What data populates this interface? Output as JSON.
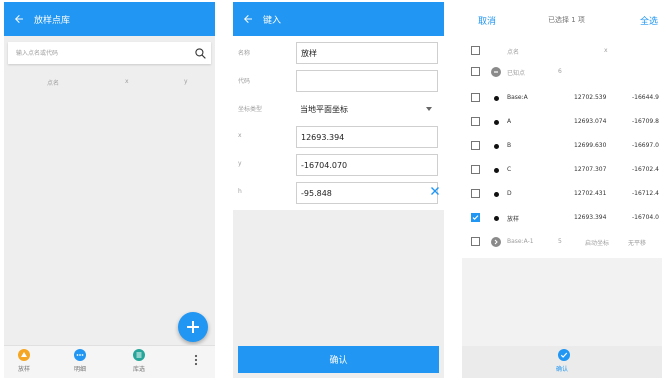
{
  "screen1": {
    "title": "放样点库",
    "search_placeholder": "输入点名或代码",
    "columns": [
      "点名",
      "x",
      "y"
    ],
    "nav": [
      {
        "label": "放样",
        "color": "#f5a623"
      },
      {
        "label": "明细",
        "color": "#2196f3"
      },
      {
        "label": "库选",
        "color": "#26a69a"
      }
    ]
  },
  "screen2": {
    "title": "键入",
    "fields": {
      "name": {
        "label": "名称",
        "value": "放样"
      },
      "code": {
        "label": "代码",
        "value": ""
      },
      "coord_type": {
        "label": "坐标类型",
        "value": "当地平面坐标"
      },
      "x": {
        "label": "x",
        "value": "12693.394"
      },
      "y": {
        "label": "y",
        "value": "-16704.070"
      },
      "h": {
        "label": "h",
        "value": "-95.848"
      }
    },
    "confirm": "确认"
  },
  "screen3": {
    "cancel": "取消",
    "selected": "已选择 1 项",
    "select_all": "全选",
    "header": {
      "name": "点名",
      "x": "x"
    },
    "group": {
      "label": "已知点",
      "count": "6"
    },
    "rows": [
      {
        "name": "Base:A",
        "x": "12702.539",
        "y": "-16644.9",
        "checked": false
      },
      {
        "name": "A",
        "x": "12693.074",
        "y": "-16709.8",
        "checked": false
      },
      {
        "name": "B",
        "x": "12699.630",
        "y": "-16697.0",
        "checked": false
      },
      {
        "name": "C",
        "x": "12707.307",
        "y": "-16702.4",
        "checked": false
      },
      {
        "name": "D",
        "x": "12702.431",
        "y": "-16712.4",
        "checked": false
      },
      {
        "name": "放样",
        "x": "12693.394",
        "y": "-16704.0",
        "checked": true
      }
    ],
    "base_row": {
      "name": "Base:A-1",
      "count": "5",
      "col2": "启动坐标",
      "col3": "无平移"
    },
    "confirm": "确认"
  },
  "colors": {
    "primary": "#2196f3",
    "fab": "#2196f3",
    "accent_orange": "#f5a623",
    "accent_teal": "#26a69a"
  }
}
